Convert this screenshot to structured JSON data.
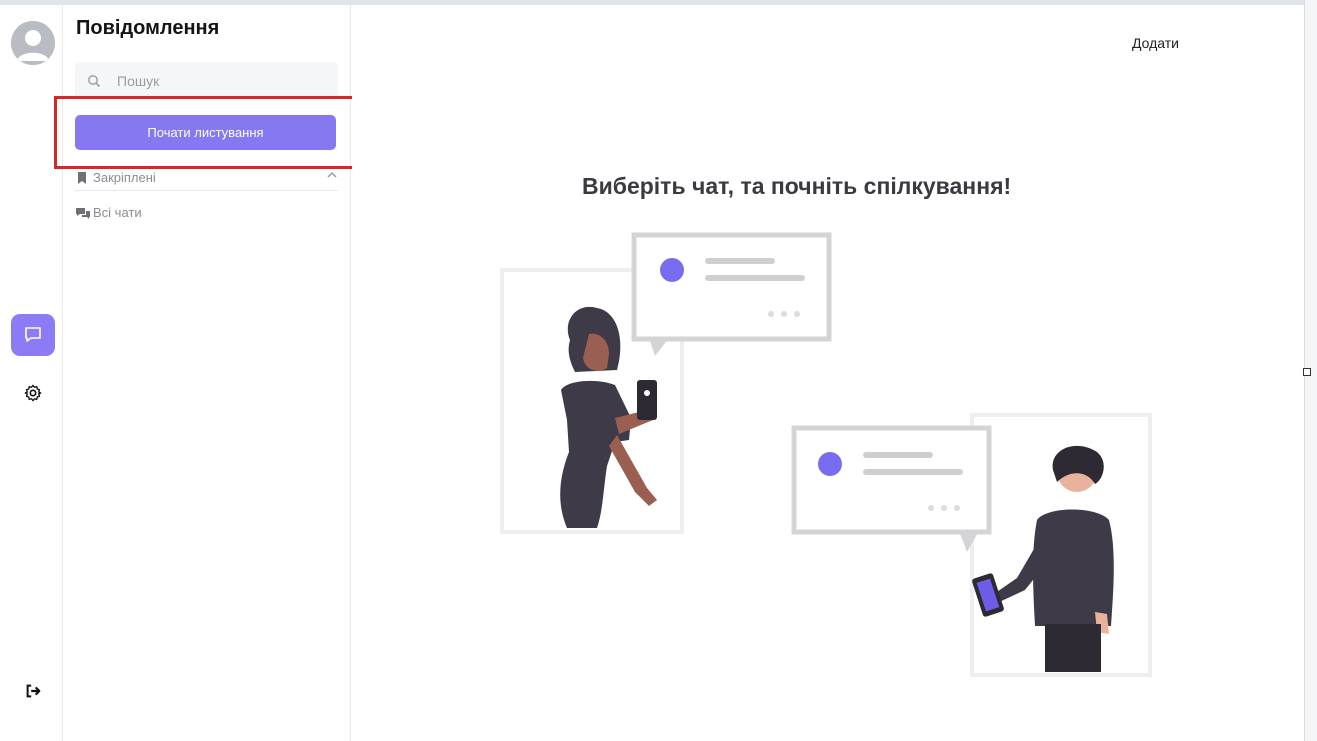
{
  "sidebar": {
    "title": "Повідомлення",
    "search": {
      "placeholder": "Пошук"
    },
    "start_button_label": "Почати листування",
    "sections": [
      {
        "label": "Закріплені"
      },
      {
        "label": "Всі чати"
      }
    ]
  },
  "main": {
    "add_label": "Додати",
    "empty_state_title": "Виберіть чат, та почніть спілкування!"
  },
  "rail": {
    "items": [
      {
        "icon": "chat-icon",
        "active": true
      },
      {
        "icon": "gear-icon",
        "active": false
      },
      {
        "icon": "logout-icon",
        "active": false
      }
    ]
  },
  "colors": {
    "accent": "#8678f0",
    "highlight": "#d62828",
    "illustration_dark": "#3f3a48",
    "illustration_skin": "#9b5f52"
  }
}
